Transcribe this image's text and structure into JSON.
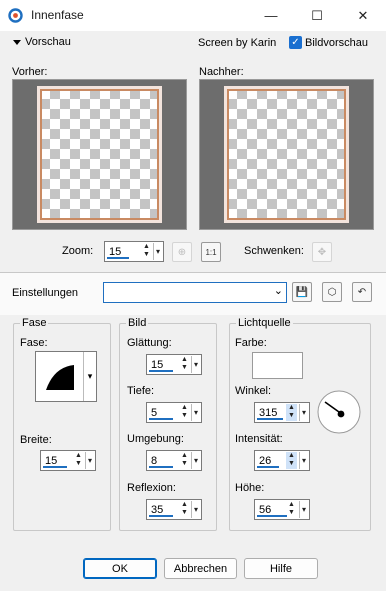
{
  "window": {
    "title": "Innenfase",
    "minimize": "—",
    "maximize": "☐",
    "close": "✕"
  },
  "top": {
    "preview_toggle": "Vorschau",
    "credit": "Screen by Karin",
    "bild_preview_label": "Bildvorschau",
    "bild_preview_checked": true
  },
  "preview": {
    "before_label": "Vorher:",
    "after_label": "Nachher:",
    "zoom_label": "Zoom:",
    "zoom_value": "15",
    "pan_label": "Schwenken:"
  },
  "settings": {
    "label": "Einstellungen",
    "preset_value": ""
  },
  "fase": {
    "title": "Fase",
    "fase_label": "Fase:",
    "breite_label": "Breite:",
    "breite_value": "15"
  },
  "bild": {
    "title": "Bild",
    "glaettung_label": "Glättung:",
    "glaettung_value": "15",
    "tiefe_label": "Tiefe:",
    "tiefe_value": "5",
    "umgebung_label": "Umgebung:",
    "umgebung_value": "8",
    "reflexion_label": "Reflexion:",
    "reflexion_value": "35"
  },
  "licht": {
    "title": "Lichtquelle",
    "farbe_label": "Farbe:",
    "winkel_label": "Winkel:",
    "winkel_value": "315",
    "intensitaet_label": "Intensität:",
    "intensitaet_value": "26",
    "hoehe_label": "Höhe:",
    "hoehe_value": "56"
  },
  "buttons": {
    "ok": "OK",
    "cancel": "Abbrechen",
    "help": "Hilfe"
  },
  "colors": {
    "accent": "#1f6fc0",
    "preview_bg": "#6d6d6d",
    "frame_copper": "#c98a62"
  }
}
